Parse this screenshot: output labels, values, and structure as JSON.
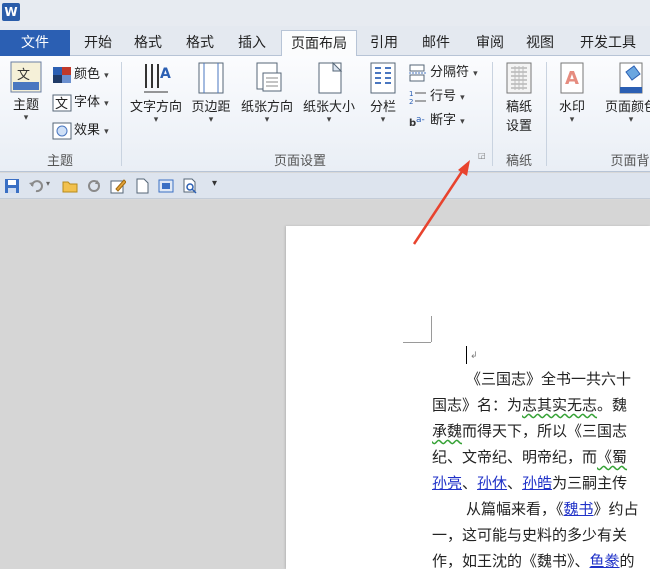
{
  "app": {
    "logo": "W"
  },
  "tabs": {
    "file": "文件",
    "items": [
      "开始",
      "格式",
      "格式",
      "插入",
      "页面布局",
      "引用",
      "邮件",
      "审阅",
      "视图",
      "开发工具"
    ]
  },
  "ribbon": {
    "theme_group": {
      "label": "主题",
      "theme_btn": "主题",
      "colors": "颜色",
      "fonts": "字体",
      "effects": "效果"
    },
    "page_setup_group": {
      "label": "页面设置",
      "text_direction": "文字方向",
      "margins": "页边距",
      "orientation": "纸张方向",
      "size": "纸张大小",
      "columns": "分栏",
      "breaks": "分隔符",
      "line_numbers": "行号",
      "hyphenation": "断字"
    },
    "draft_group": {
      "label": "稿纸",
      "draft_settings_line1": "稿纸",
      "draft_settings_line2": "设置"
    },
    "background_group": {
      "label": "页面背",
      "watermark": "水印",
      "page_color": "页面颜色"
    }
  },
  "qat": {
    "customize": "▾"
  },
  "document": {
    "line1": "《三国志》全书一共六十",
    "line2a": "国志》名：为",
    "line2b": "志其实无志",
    "line2c": "。魏",
    "line3a": "承魏",
    "line3b": "而得天下，所以《三国志",
    "line4a": "纪、文帝纪、明帝纪，而",
    "line4b": "《蜀",
    "line5a": "孙亮",
    "line5b": "、",
    "line5c": "孙休",
    "line5d": "、",
    "line5e": "孙皓",
    "line5f": "为三嗣主传",
    "line6a": "从篇幅来看，《",
    "line6b": "魏书",
    "line6c": "》约占",
    "line7": "一，这可能与史料的多少有关",
    "line8a": "作，如王沈的《魏书》、",
    "line8b": "鱼豢",
    "line8c": "的"
  },
  "colors": {
    "accent": "#2b5fb3",
    "arrow": "#e8432e",
    "link": "#2032c8"
  }
}
